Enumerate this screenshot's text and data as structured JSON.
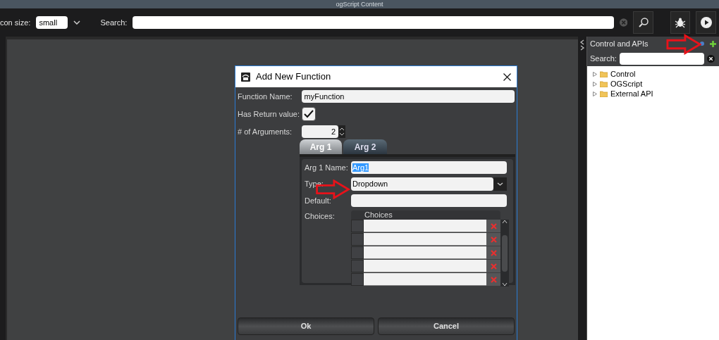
{
  "window": {
    "title": "ogScript Content"
  },
  "toolbar": {
    "icon_size_label": "con size:",
    "icon_size": "small",
    "search_label": "Search:"
  },
  "side_panel": {
    "title": "Control and APIs",
    "search_label": "Search:",
    "tree": [
      {
        "label": "Control",
        "expanded": false
      },
      {
        "label": "OGScript",
        "expanded": false
      },
      {
        "label": "External API",
        "expanded": false
      }
    ]
  },
  "dialog": {
    "title": "Add New Function",
    "function_name_label": "Function Name:",
    "function_name": "myFunction",
    "has_return_label": "Has Return value:",
    "has_return": true,
    "arguments_label": "# of Arguments:",
    "arguments": "2",
    "tabs": [
      {
        "label": "Arg 1",
        "selected": true
      },
      {
        "label": "Arg 2",
        "selected": false
      }
    ],
    "arg_name_label": "Arg 1 Name:",
    "arg_name": "Arg1",
    "arg_name_selected": true,
    "type_label": "Type:",
    "type": "Dropdown",
    "default_label": "Default:",
    "choices_label": "Choices:",
    "choices_header": "Choices",
    "choices": [
      {
        "kind": "empty-row"
      },
      {
        "kind": "empty-row"
      },
      {
        "kind": "empty-row"
      },
      {
        "kind": "empty-row"
      },
      {
        "kind": "empty-row"
      }
    ],
    "buttons": [
      {
        "label": "Ok"
      },
      {
        "label": "Cancel"
      }
    ]
  },
  "annotations": [
    {
      "kind": "arrow"
    },
    {
      "kind": "arrow"
    }
  ]
}
